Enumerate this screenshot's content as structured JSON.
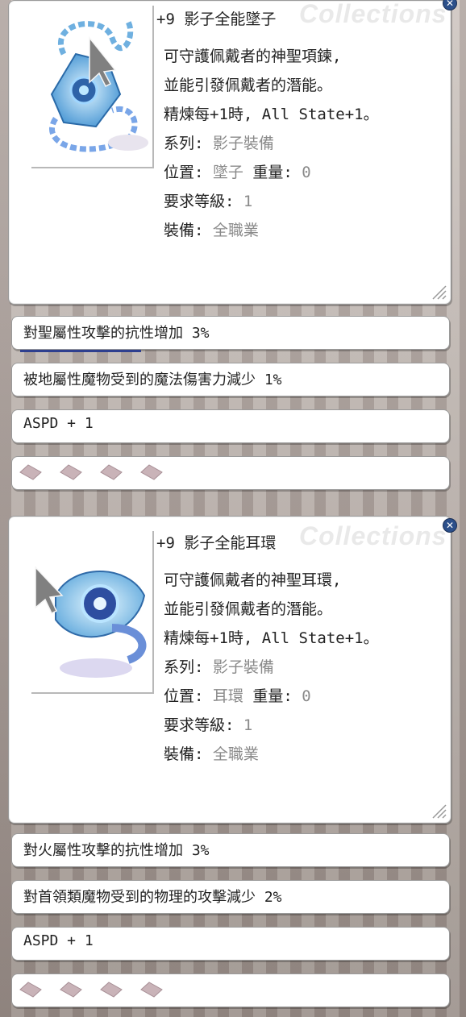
{
  "colors": {
    "window_bg": "#ffffff",
    "muted_text": "#8a8a8a",
    "close_button": "#2b4f8a",
    "watermark": "#e9e9e9"
  },
  "cards": [
    {
      "title": "+9 影子全能墜子",
      "watermark": "Collections",
      "icon": "shadow-pendant-icon",
      "lines": [
        "可守護佩戴者的神聖項鍊,",
        "並能引發佩戴者的潛能。",
        "精煉每+1時, All State+1。"
      ],
      "series_label": "系列:",
      "series_value": "影子裝備",
      "position_label": "位置:",
      "position_value": "墜子",
      "weight_label": "重量:",
      "weight_value": "0",
      "level_label": "要求等級:",
      "level_value": "1",
      "equip_label": "裝備:",
      "equip_value": "全職業",
      "options": [
        "對聖屬性攻擊的抗性增加 3%",
        "被地屬性魔物受到的魔法傷害力減少 1%",
        "ASPD + 1"
      ],
      "slot_count": 4
    },
    {
      "title": "+9 影子全能耳環",
      "watermark": "Collections",
      "icon": "shadow-earring-icon",
      "lines": [
        "可守護佩戴者的神聖耳環,",
        "並能引發佩戴者的潛能。",
        "精煉每+1時, All State+1。"
      ],
      "series_label": "系列:",
      "series_value": "影子裝備",
      "position_label": "位置:",
      "position_value": "耳環",
      "weight_label": "重量:",
      "weight_value": "0",
      "level_label": "要求等級:",
      "level_value": "1",
      "equip_label": "裝備:",
      "equip_value": "全職業",
      "options": [
        "對火屬性攻擊的抗性增加 3%",
        "對首領類魔物受到的物理的攻擊減少 2%",
        "ASPD + 1"
      ],
      "slot_count": 4
    }
  ]
}
